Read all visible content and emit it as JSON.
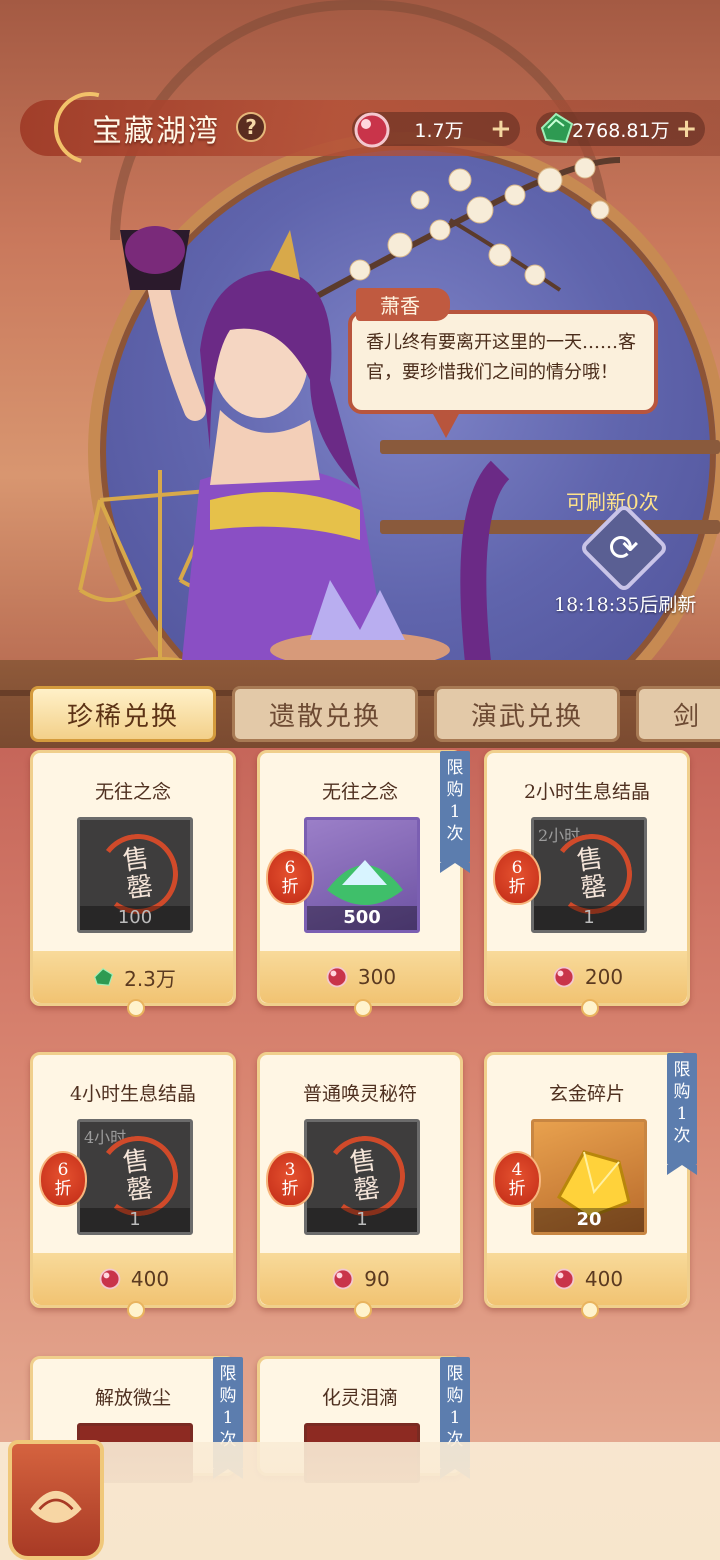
{
  "header": {
    "title": "宝藏湖湾",
    "help_label": "?",
    "currencies": [
      {
        "icon": "pink-orb-icon",
        "value": "1.7万",
        "plus": "+"
      },
      {
        "icon": "green-jade-icon",
        "value": "2768.81万",
        "plus": "+"
      }
    ]
  },
  "npc": {
    "name": "萧香",
    "dialog": "香儿终有要离开这里的一天……客官，要珍惜我们之间的情分哦！"
  },
  "refresh": {
    "count_text": "可刷新0次",
    "timer_text": "18:18:35后刷新",
    "icon": "refresh-icon"
  },
  "tabs": [
    {
      "label": "珍稀兑换",
      "active": true
    },
    {
      "label": "遗散兑换",
      "active": false
    },
    {
      "label": "演武兑换",
      "active": false
    },
    {
      "label": "剑",
      "active": false
    }
  ],
  "items": [
    {
      "name": "无往之念",
      "qty": "100",
      "sold_out": "售罄",
      "discount": "",
      "limit": "",
      "price": "2.3万",
      "currency": "green-jade-icon",
      "box": "gray",
      "sublabel": ""
    },
    {
      "name": "无往之念",
      "qty": "500",
      "sold_out": "",
      "discount": "6折",
      "limit": "限购1次",
      "price": "300",
      "currency": "pink-orb-icon",
      "box": "purple",
      "sublabel": ""
    },
    {
      "name": "2小时生息结晶",
      "qty": "1",
      "sold_out": "售罄",
      "discount": "6折",
      "limit": "",
      "price": "200",
      "currency": "pink-orb-icon",
      "box": "gray",
      "sublabel": "2小时"
    },
    {
      "name": "4小时生息结晶",
      "qty": "1",
      "sold_out": "售罄",
      "discount": "6折",
      "limit": "",
      "price": "400",
      "currency": "pink-orb-icon",
      "box": "gray",
      "sublabel": "4小时"
    },
    {
      "name": "普通唤灵秘符",
      "qty": "1",
      "sold_out": "售罄",
      "discount": "3折",
      "limit": "",
      "price": "90",
      "currency": "pink-orb-icon",
      "box": "gray",
      "sublabel": ""
    },
    {
      "name": "玄金碎片",
      "qty": "20",
      "sold_out": "",
      "discount": "4折",
      "limit": "限购1次",
      "price": "400",
      "currency": "pink-orb-icon",
      "box": "orange",
      "sublabel": ""
    },
    {
      "name": "解放微尘",
      "qty": "",
      "sold_out": "",
      "discount": "",
      "limit": "限购1次",
      "price": "",
      "currency": "",
      "box": "red",
      "sublabel": ""
    },
    {
      "name": "化灵泪滴",
      "qty": "",
      "sold_out": "",
      "discount": "",
      "limit": "限购1次",
      "price": "",
      "currency": "",
      "box": "red",
      "sublabel": ""
    }
  ],
  "colors": {
    "accent": "#c05a40",
    "tab_active": "#f3d08a",
    "limit_tag": "#5c7dae",
    "discount": "#d8401f"
  }
}
